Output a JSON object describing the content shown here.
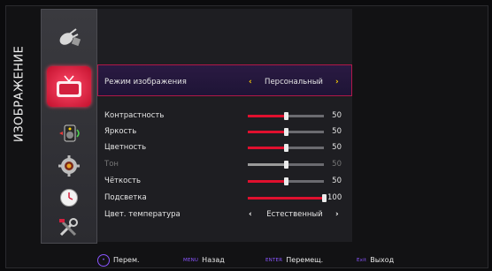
{
  "menu": {
    "section_title": "ИЗОБРАЖЕНИЕ",
    "icons": [
      "satellite-icon",
      "tv-icon",
      "audio-icon",
      "settings-icon",
      "clock-icon",
      "tools-icon"
    ],
    "selected_icon": "tv-icon"
  },
  "picture_mode": {
    "label": "Режим изображения",
    "value": "Персональный"
  },
  "settings": [
    {
      "label": "Контрастность",
      "value": "50",
      "level": 0.5,
      "enabled": true
    },
    {
      "label": "Яркость",
      "value": "50",
      "level": 0.5,
      "enabled": true
    },
    {
      "label": "Цветность",
      "value": "50",
      "level": 0.5,
      "enabled": true
    },
    {
      "label": "Тон",
      "value": "50",
      "level": 0.5,
      "enabled": false
    },
    {
      "label": "Чёткость",
      "value": "50",
      "level": 0.5,
      "enabled": true
    },
    {
      "label": "Подсветка",
      "value": "100",
      "level": 1.0,
      "enabled": true
    }
  ],
  "color_temp": {
    "label": "Цвет. температура",
    "value": "Естественный"
  },
  "footer": {
    "move_label": "Перем.",
    "menu_key": "MENU",
    "back_label": "Назад",
    "enter_key": "ENTER",
    "enter_label": "Перемещ.",
    "exit_key": "Exit",
    "exit_label": "Выход"
  },
  "colors": {
    "accent": "#e0102e",
    "highlight_border": "#b01848",
    "arrow": "#ffd200",
    "key": "#8a55ff"
  }
}
